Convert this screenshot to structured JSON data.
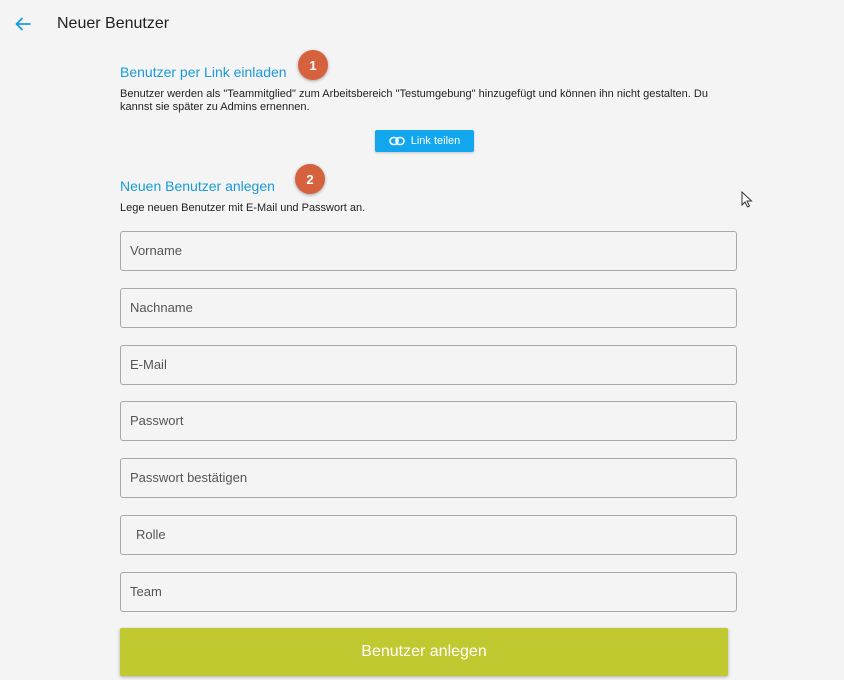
{
  "header": {
    "title": "Neuer Benutzer",
    "back_icon": "arrow-left-icon",
    "accent_color": "#1a9ad9"
  },
  "invite_section": {
    "title": "Benutzer per Link einladen",
    "marker": "1",
    "description_line1": "Benutzer werden als \"Teammitglied\" zum Arbeitsbereich \"Testumgebung\" hinzugefügt und können ihn nicht gestalten. Du",
    "description_line2": "kannst sie später zu Admins ernennen.",
    "share_button_label": "Link teilen",
    "share_button_icon": "link-icon",
    "share_button_color": "#12a6ee"
  },
  "create_section": {
    "title": "Neuen Benutzer anlegen",
    "marker": "2",
    "description": "Lege neuen Benutzer mit E-Mail und Passwort an.",
    "fields": {
      "firstname_placeholder": "Vorname",
      "lastname_placeholder": "Nachname",
      "email_placeholder": "E-Mail",
      "password_placeholder": "Passwort",
      "password_confirm_placeholder": "Passwort bestätigen",
      "role_placeholder": "Rolle",
      "team_placeholder": "Team"
    },
    "submit_label": "Benutzer anlegen",
    "submit_color": "#c1c930"
  },
  "marker_color": "#d6613d"
}
